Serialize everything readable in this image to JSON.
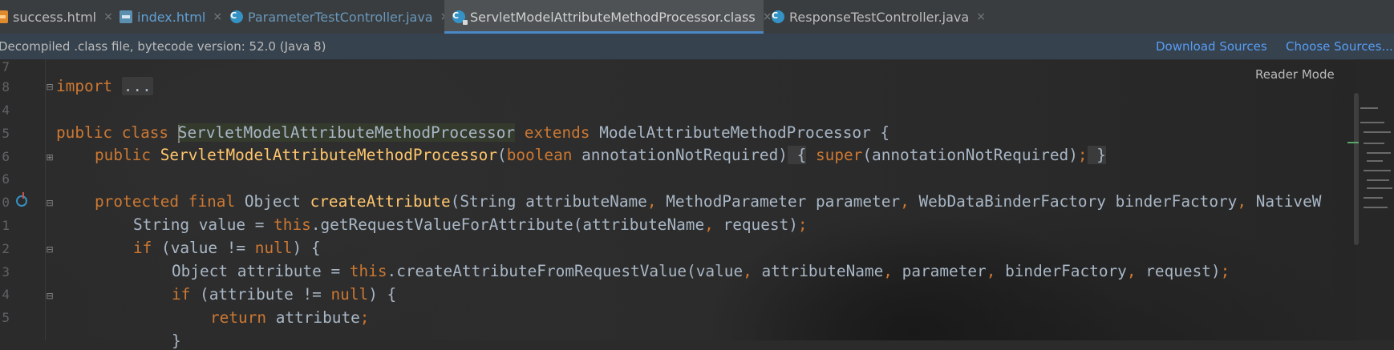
{
  "tabs": [
    {
      "label": "success.html",
      "icon": "html-file-icon",
      "active": false
    },
    {
      "label": "index.html",
      "icon": "html-file-icon",
      "active": false
    },
    {
      "label": "ParameterTestController.java",
      "icon": "java-class-icon",
      "active": false
    },
    {
      "label": "ServletModelAttributeMethodProcessor.class",
      "icon": "compiled-class-icon",
      "active": true
    },
    {
      "label": "ResponseTestController.java",
      "icon": "java-class-icon",
      "active": false
    }
  ],
  "tab_close_glyph": "×",
  "class_icon_letter": "C",
  "banner": {
    "message": "Decompiled .class file, bytecode version: 52.0 (Java 8)",
    "download_sources": "Download Sources",
    "choose_sources": "Choose Sources..."
  },
  "reader_mode": "Reader Mode",
  "line_numbers": [
    "7",
    "8",
    "4",
    "5",
    "6",
    "6",
    "0",
    "1",
    "2",
    "3",
    "4",
    "5"
  ],
  "code": {
    "line_import_kw": "import",
    "line_import_dots": "...",
    "class_public": "public",
    "class_class": "class",
    "class_name": "ServletModelAttributeMethodProcessor",
    "class_extends": "extends",
    "class_super": "ModelAttributeMethodProcessor {",
    "ctor_public": "public",
    "ctor_name": "ServletModelAttributeMethodProcessor",
    "ctor_open": "(",
    "ctor_type": "boolean",
    "ctor_param": " annotationNotRequired)",
    "ctor_brace": " {",
    "ctor_super": " super",
    "ctor_args": "(annotationNotRequired)",
    "ctor_semi": ";",
    "ctor_close": " }",
    "m_protected": "protected",
    "m_final": "final",
    "m_type": "Object",
    "m_name": "createAttribute",
    "m_p1": "(String attributeName",
    "m_c1": ",",
    "m_p2": " MethodParameter parameter",
    "m_c2": ",",
    "m_p3": " WebDataBinderFactory binderFactory",
    "m_c3": ",",
    "m_p4": " NativeW",
    "l1_a": "String value = ",
    "l1_this": "this",
    "l1_b": ".getRequestValueForAttribute(attributeName",
    "l1_c": ",",
    "l1_d": " request)",
    "l1_semi": ";",
    "l2_if": "if",
    "l2_a": " (value != ",
    "l2_null": "null",
    "l2_b": ") {",
    "l3_a": "Object attribute = ",
    "l3_this": "this",
    "l3_b": ".createAttributeFromRequestValue(value",
    "l3_c1": ",",
    "l3_d": " attributeName",
    "l3_c2": ",",
    "l3_e": " parameter",
    "l3_c3": ",",
    "l3_f": " binderFactory",
    "l3_c4": ",",
    "l3_g": " request)",
    "l3_semi": ";",
    "l4_if": "if",
    "l4_a": " (attribute != ",
    "l4_null": "null",
    "l4_b": ") {",
    "l5_return": "return",
    "l5_a": " attribute",
    "l5_semi": ";",
    "l6_brace": "}"
  },
  "colors": {
    "keyword": "#cc7832",
    "method": "#ffc66d",
    "plain": "#a9b7c6",
    "link": "#589df6",
    "active_tab_underline": "#4a88c7"
  }
}
